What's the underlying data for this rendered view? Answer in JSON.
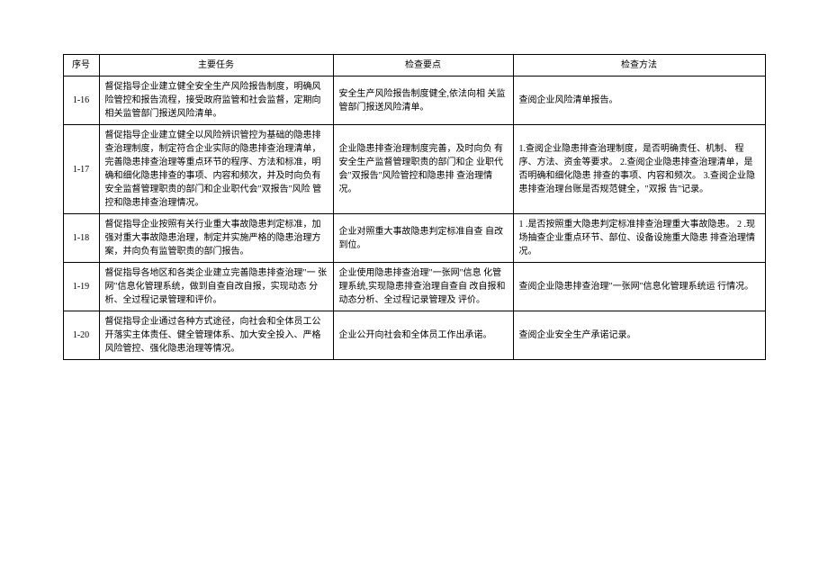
{
  "headers": {
    "idx": "序号",
    "task": "主要任务",
    "key": "检查要点",
    "method": "检查方法"
  },
  "rows": [
    {
      "idx": "1-16",
      "task": "督促指导企业建立健全安全生产风险报告制度，明确风 险管控和报告流程，接受政府监管和社会监督，定期向 相关监管部门报送风险清单。",
      "key": "安全生产风险报告制度健全,依法向相 关监管部门报送风险清单。",
      "method": "查阅企业风险清单报告。"
    },
    {
      "idx": "1-17",
      "task": "督促指导企业建立健全以风险辨识管控为基础的隐患排 查治理制度，制定符合企业实际的隐患排查治理清单， 完善隐患排查治理等重点环节的程序、方法和标准，明 确和细化隐患排查的事项、内容和频次，并及时向负有 安全监督管理职责的部门和企业职代会\"双报告\"风险 管控和隐患排查治理情况。",
      "key": "企业隐患排查治理制度完善，及时向负 有安全生产监督管理职责的部门和企 业职代会\"双报告\"风险管控和隐患排 查治理情况。",
      "method": "1.查阅企业隐患排查治理制度，是否明确责任、机制、 程序、方法、资金等要求。\n2.查阅企业隐患排查治理清单，是否明确和细化隐患 排查的事项、内容和频次。\n3.查阅企业隐患排查治理台账是否规范健全，\"双报 告\"记录。"
    },
    {
      "idx": "1-18",
      "task": "督促指导企业按照有关行业重大事故隐患判定标准，加 强对重大事故隐患治理，制定并实施严格的隐患治理方 案，并向负有监管职责的部门报告。",
      "key": "企业对照重大事故隐患判定标准自查 自改到位。",
      "method": "1 .是否按照重大隐患判定标准排查治理重大事故隐患。\n2 .现场抽查企业重点环节、部位、设备设施重大隐患 排查治理情况。"
    },
    {
      "idx": "1-19",
      "task": "督促指导各地区和各类企业建立完善隐患排查治理\"一 张网\"信息化管理系统，做到自查自改自报，实现动态 分析、全过程记录管理和评价。",
      "key": "企业使用隐患排查治理\"一张网\"信息 化管理系统,实现隐患排查治理自查自 改自报和动态分析、全过程记录管理及 评价。",
      "method": "查阅企业隐患排查治理\"一张网\"信息化管理系统运 行情况。"
    },
    {
      "idx": "1-20",
      "task": "督促指导企业通过各种方式途径，向社会和全体员工公 开落实主体责任、健全管理体系、加大安全投入、严格 风险管控、强化隐患治理等情况。",
      "key": "企业公开向社会和全体员工作出承诺。",
      "method": "查阅企业安全生产承诺记录。"
    }
  ]
}
